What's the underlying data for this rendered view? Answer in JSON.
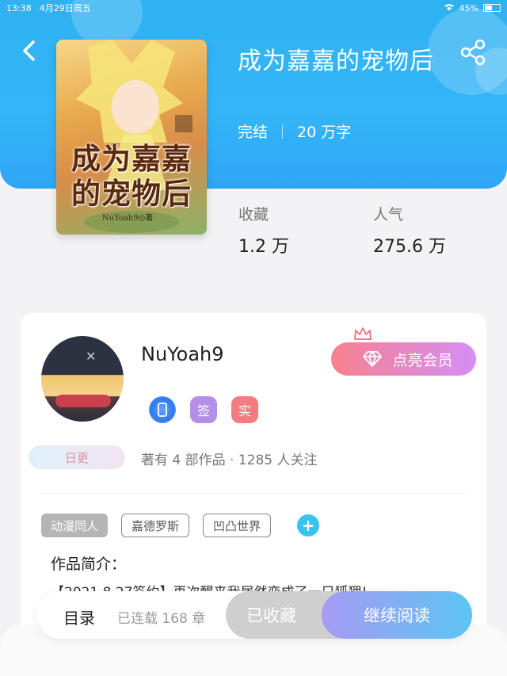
{
  "status_bar": {
    "time": "13:38",
    "date": "4月29日周五",
    "battery": "45%"
  },
  "book": {
    "title": "成为嘉嘉的宠物后",
    "status": "完结",
    "word_count": "20 万字",
    "cover_title_line1": "成为嘉嘉",
    "cover_title_line2": "的宠物后",
    "cover_author": "NuYoah9◎著"
  },
  "stats": {
    "favorites_label": "收藏",
    "favorites_value": "1.2 万",
    "popularity_label": "人气",
    "popularity_value": "275.6 万"
  },
  "author": {
    "name": "NuYoah9",
    "daily_badge": "日更",
    "vip_button": "点亮会员",
    "badge_sign": "签",
    "badge_real": "实",
    "works_info": "著有 4 部作品 · 1285 人关注"
  },
  "tags": [
    "动漫同人",
    "嘉德罗斯",
    "凹凸世界"
  ],
  "intro": {
    "label": "作品简介：",
    "text": "【2021.8.27签约】再次醒来我居然变成了一只狐狸!"
  },
  "bottom_bar": {
    "toc_label": "目录",
    "chapters": "已连载 168 章",
    "collected_label": "已收藏",
    "continue_label": "继续阅读"
  },
  "colors": {
    "header": "#34b5f8",
    "accent_pink": "#f7818e",
    "accent_purple": "#a79af5"
  }
}
